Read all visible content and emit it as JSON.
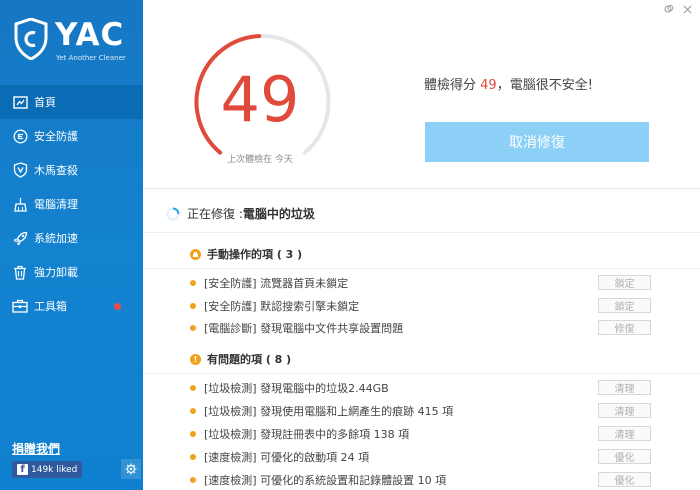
{
  "app": {
    "brand": "YAC",
    "tagline": "Yet Another Cleaner"
  },
  "sidebar": {
    "items": [
      {
        "label": "首頁",
        "icon": "home-icon",
        "active": true
      },
      {
        "label": "安全防護",
        "icon": "shield-e-icon",
        "active": false
      },
      {
        "label": "木馬查殺",
        "icon": "trojan-shield-icon",
        "active": false
      },
      {
        "label": "電腦清理",
        "icon": "broom-icon",
        "active": false
      },
      {
        "label": "系統加速",
        "icon": "rocket-icon",
        "active": false
      },
      {
        "label": "強力卸載",
        "icon": "trash-icon",
        "active": false
      },
      {
        "label": "工具箱",
        "icon": "toolbox-icon",
        "active": false,
        "badge_color": "#f04a4a"
      }
    ],
    "donate_label": "捐贈我們",
    "facebook_label": "149k liked"
  },
  "score": {
    "value": "49",
    "last_check": "上次體檢在 今天",
    "headline_prefix": "體檢得分 ",
    "headline_number": "49",
    "headline_suffix": "，電腦很不安全!",
    "cancel_label": "取消修復",
    "gauge_fraction": 0.49
  },
  "progress": {
    "prefix": "正在修復 :",
    "target": "電腦中的垃圾"
  },
  "sections": [
    {
      "title": "手動操作的項 ( 3 )",
      "icon": "manual-warning-icon",
      "rows": [
        {
          "text": "[安全防護] 流覽器首頁未鎖定",
          "action": "鎖定"
        },
        {
          "text": "[安全防護] 默認搜索引擎未鎖定",
          "action": "鎖定"
        },
        {
          "text": "[電腦診斷] 發現電腦中文件共享設置問題",
          "action": "修復"
        }
      ]
    },
    {
      "title": "有問題的項 ( 8 )",
      "icon": "problem-warning-icon",
      "rows": [
        {
          "text": "[垃圾檢測] 發現電腦中的垃圾2.44GB",
          "action": "清理"
        },
        {
          "text": "[垃圾檢測] 發現使用電腦和上網產生的痕跡 415 項",
          "action": "清理"
        },
        {
          "text": "[垃圾檢測] 發現註冊表中的多餘項 138 項",
          "action": "清理"
        },
        {
          "text": "[速度檢測] 可優化的啟動項 24 項",
          "action": "優化"
        },
        {
          "text": "[速度檢測] 可優化的系統設置和記錄體設置 10 項",
          "action": "優化"
        }
      ]
    }
  ],
  "colors": {
    "accent_blue": "#1382cf",
    "score_red": "#e04a3a",
    "warning_orange": "#f0a21c",
    "button_blue": "#8cd0f7"
  }
}
